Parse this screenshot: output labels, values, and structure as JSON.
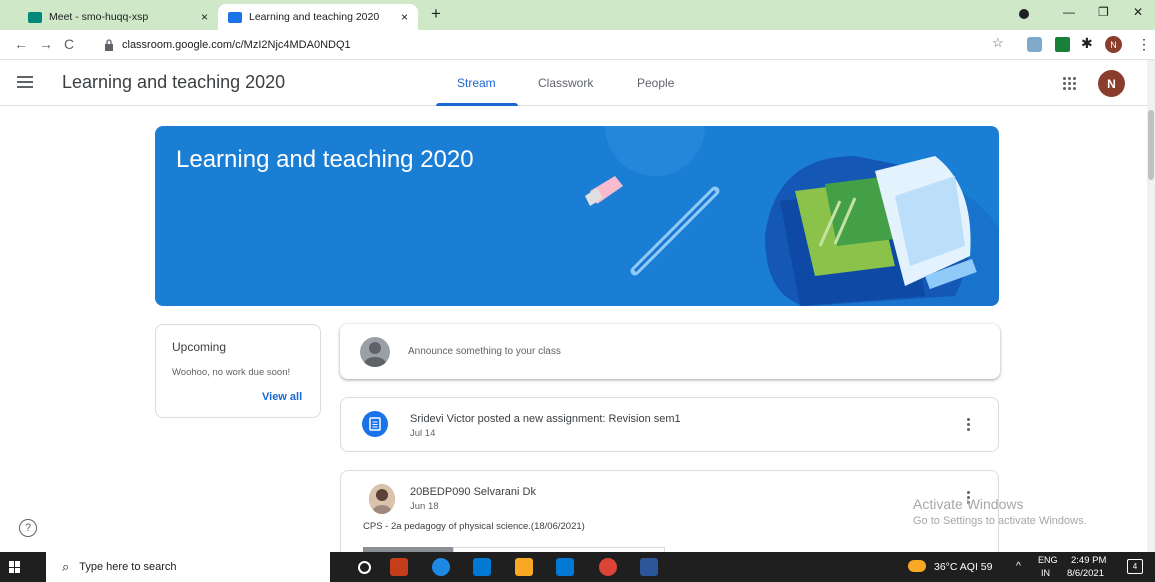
{
  "browser": {
    "tabs": [
      {
        "title": "Meet - smo-huqq-xsp",
        "close": "×"
      },
      {
        "title": "Learning and teaching 2020",
        "close": "×"
      }
    ],
    "new_tab": "+",
    "window_controls": {
      "minimize": "—",
      "restore": "❐",
      "close": "✕"
    },
    "url": "classroom.google.com/c/MzI2Njc4MDA0NDQ1",
    "profile_initial": "N"
  },
  "header": {
    "class_title": "Learning and teaching 2020",
    "tabs": [
      {
        "label": "Stream"
      },
      {
        "label": "Classwork"
      },
      {
        "label": "People"
      }
    ],
    "avatar_initial": "N"
  },
  "banner": {
    "title": "Learning and teaching 2020",
    "color": "#1a7fd4"
  },
  "upcoming": {
    "title": "Upcoming",
    "text": "Woohoo, no work due soon!",
    "link": "View all"
  },
  "announce": {
    "placeholder": "Announce something to your class"
  },
  "stream": {
    "assignment": {
      "title": "Sridevi Victor posted a new assignment: Revision sem1",
      "date": "Jul 14"
    },
    "post": {
      "author": "20BEDP090 Selvarani Dk",
      "date": "Jun 18",
      "body": "CPS - 2a pedagogy of physical science.(18/06/2021)"
    }
  },
  "watermark": {
    "line1": "Activate Windows",
    "line2": "Go to Settings to activate Windows."
  },
  "help": "?",
  "taskbar": {
    "search_placeholder": "Type here to search",
    "weather": "36°C  AQI 59",
    "lang": "ENG",
    "region": "IN",
    "time": "2:49 PM",
    "date": "8/6/2021",
    "notifications": "4"
  },
  "colors": {
    "accent": "#1967d2",
    "tabstrip": "#cfe8c7",
    "taskbar": "#1f1f1f"
  }
}
